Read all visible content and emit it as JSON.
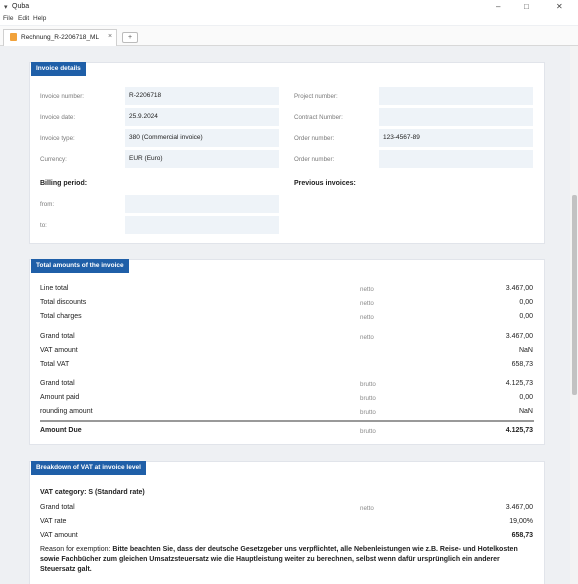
{
  "window": {
    "title": "Quba",
    "minimize": "–",
    "maximize": "□",
    "close": "✕"
  },
  "menu": [
    "File",
    "Edit",
    "Help"
  ],
  "tab": {
    "label": "Rechnung_R-2206718_ML",
    "close": "×",
    "add": "+"
  },
  "invoice_details": {
    "heading": "Invoice details",
    "fields": {
      "invoice_number": {
        "label": "Invoice number:",
        "value": "R-2206718"
      },
      "invoice_date": {
        "label": "Invoice date:",
        "value": "25.9.2024"
      },
      "invoice_type": {
        "label": "Invoice type:",
        "value": "380 (Commercial invoice)"
      },
      "currency": {
        "label": "Currency:",
        "value": "EUR (Euro)"
      },
      "project_number": {
        "label": "Project number:",
        "value": ""
      },
      "contract_number": {
        "label": "Contract Number:",
        "value": ""
      },
      "order_number": {
        "label": "Order number:",
        "value": "123-4567-89"
      },
      "order_number_2": {
        "label": "Order number:",
        "value": ""
      }
    },
    "billing_period": {
      "heading": "Billing period:",
      "from_label": "from:",
      "from_value": "",
      "to_label": "to:",
      "to_value": ""
    },
    "previous_invoices": {
      "heading": "Previous invoices:"
    }
  },
  "totals": {
    "heading": "Total amounts of the invoice",
    "rows": [
      {
        "label": "Line total",
        "kind": "netto",
        "value": "3.467,00"
      },
      {
        "label": "Total discounts",
        "kind": "netto",
        "value": "0,00"
      },
      {
        "label": "Total charges",
        "kind": "netto",
        "value": "0,00"
      },
      {
        "label": "Grand total",
        "kind": "netto",
        "value": "3.467,00"
      },
      {
        "label": "VAT amount",
        "kind": "",
        "value": "NaN"
      },
      {
        "label": "Total VAT",
        "kind": "",
        "value": "658,73"
      },
      {
        "label": "Grand total",
        "kind": "brutto",
        "value": "4.125,73"
      },
      {
        "label": "Amount paid",
        "kind": "brutto",
        "value": "0,00"
      },
      {
        "label": "rounding amount",
        "kind": "brutto",
        "value": "NaN"
      }
    ],
    "due": {
      "label": "Amount Due",
      "kind": "brutto",
      "value": "4.125,73"
    }
  },
  "vat_breakdown": {
    "heading": "Breakdown of VAT at invoice level",
    "category": "VAT category: S (Standard rate)",
    "rows": [
      {
        "label": "Grand total",
        "kind": "netto",
        "value": "3.467,00"
      },
      {
        "label": "VAT rate",
        "kind": "",
        "value": "19,00%"
      },
      {
        "label": "VAT amount",
        "kind": "",
        "value": "658,73"
      }
    ],
    "reason_label": "Reason for exemption:",
    "reason_text": "Bitte beachten Sie, dass der deutsche Gesetzgeber uns verpflichtet, alle Nebenleistungen wie z.B. Reise- und Hotelkosten sowie Fachbücher zum gleichen Umsatzsteuersatz wie die Hauptleistung weiter zu berechnen, selbst wenn dafür ursprünglich ein anderer Steuersatz galt."
  }
}
